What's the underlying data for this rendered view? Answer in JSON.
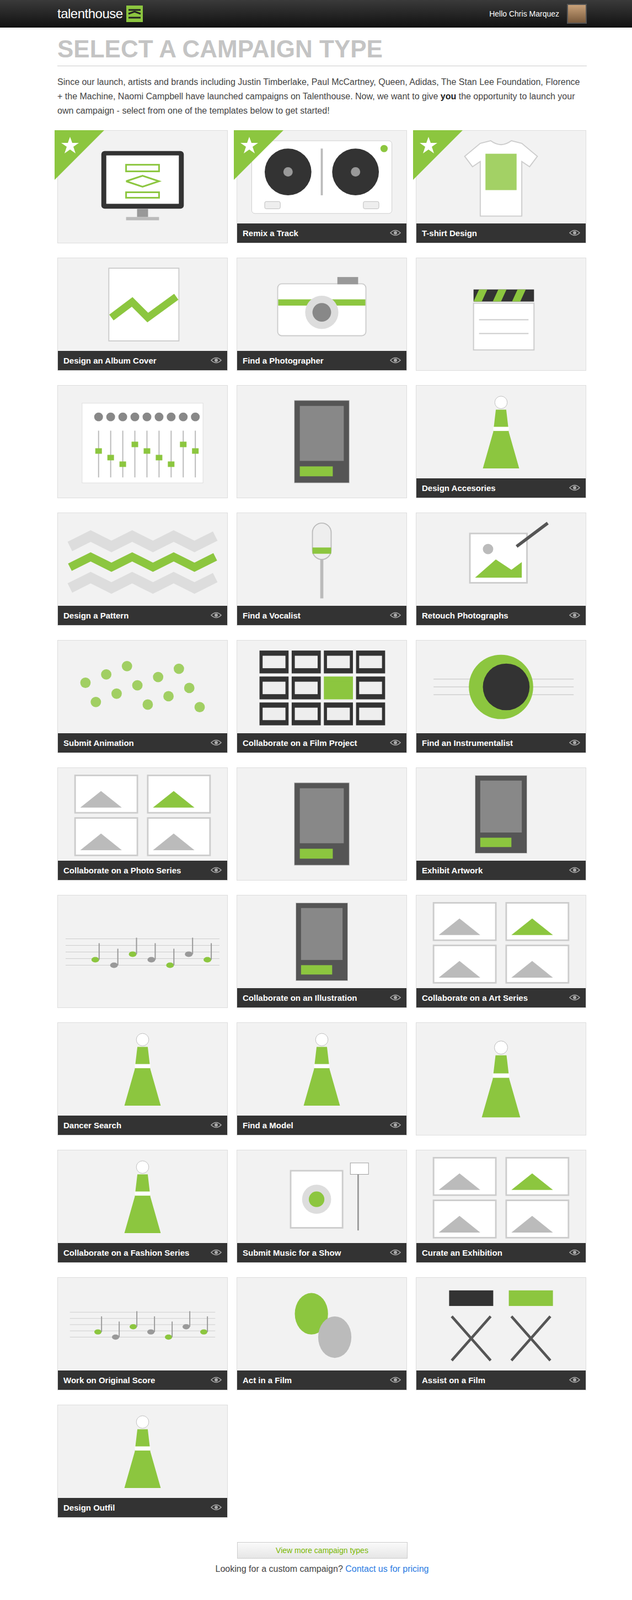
{
  "header": {
    "logo": "talenthouse",
    "greeting": "Hello Chris Marquez"
  },
  "page": {
    "title": "SELECT A CAMPAIGN TYPE",
    "intro_before": "Since our launch, artists and brands including Justin Timberlake, Paul McCartney, Queen, Adidas, The Stan Lee Foundation, Florence + the Machine, Naomi Campbell have launched campaigns on Talenthouse. Now, we want to give ",
    "intro_emphasis": "you",
    "intro_after": " the opportunity to launch your own campaign - select from one of the templates below to get started!"
  },
  "tiles": [
    {
      "caption": "",
      "featured": true
    },
    {
      "caption": "Remix a Track",
      "featured": true
    },
    {
      "caption": "T-shirt Design",
      "featured": true
    },
    {
      "caption": "Design an Album Cover",
      "featured": false
    },
    {
      "caption": "Find a Photographer",
      "featured": false
    },
    {
      "caption": "",
      "featured": false
    },
    {
      "caption": "",
      "featured": false
    },
    {
      "caption": "",
      "featured": false
    },
    {
      "caption": "Design Accesories",
      "featured": false
    },
    {
      "caption": "Design a Pattern",
      "featured": false
    },
    {
      "caption": "Find a Vocalist",
      "featured": false
    },
    {
      "caption": "Retouch Photographs",
      "featured": false
    },
    {
      "caption": "Submit Animation",
      "featured": false
    },
    {
      "caption": "Collaborate on a Film Project",
      "featured": false
    },
    {
      "caption": "Find an Instrumentalist",
      "featured": false
    },
    {
      "caption": "Collaborate on a Photo Series",
      "featured": false
    },
    {
      "caption": "",
      "featured": false
    },
    {
      "caption": "Exhibit Artwork",
      "featured": false
    },
    {
      "caption": "",
      "featured": false
    },
    {
      "caption": "Collaborate on an Illustration",
      "featured": false
    },
    {
      "caption": "Collaborate on a Art Series",
      "featured": false
    },
    {
      "caption": "Dancer Search",
      "featured": false
    },
    {
      "caption": "Find a Model",
      "featured": false
    },
    {
      "caption": "",
      "featured": false
    },
    {
      "caption": "Collaborate on a Fashion Series",
      "featured": false
    },
    {
      "caption": "Submit Music for a Show",
      "featured": false
    },
    {
      "caption": "Curate an Exhibition",
      "featured": false
    },
    {
      "caption": "Work on Original Score",
      "featured": false
    },
    {
      "caption": "Act in a Film",
      "featured": false
    },
    {
      "caption": "Assist on a Film",
      "featured": false
    },
    {
      "caption": "Design Outfil",
      "featured": false
    }
  ],
  "footer": {
    "more_button": "View more campaign types",
    "custom_text": "Looking for a custom campaign?",
    "custom_link": "Contact us for pricing"
  }
}
